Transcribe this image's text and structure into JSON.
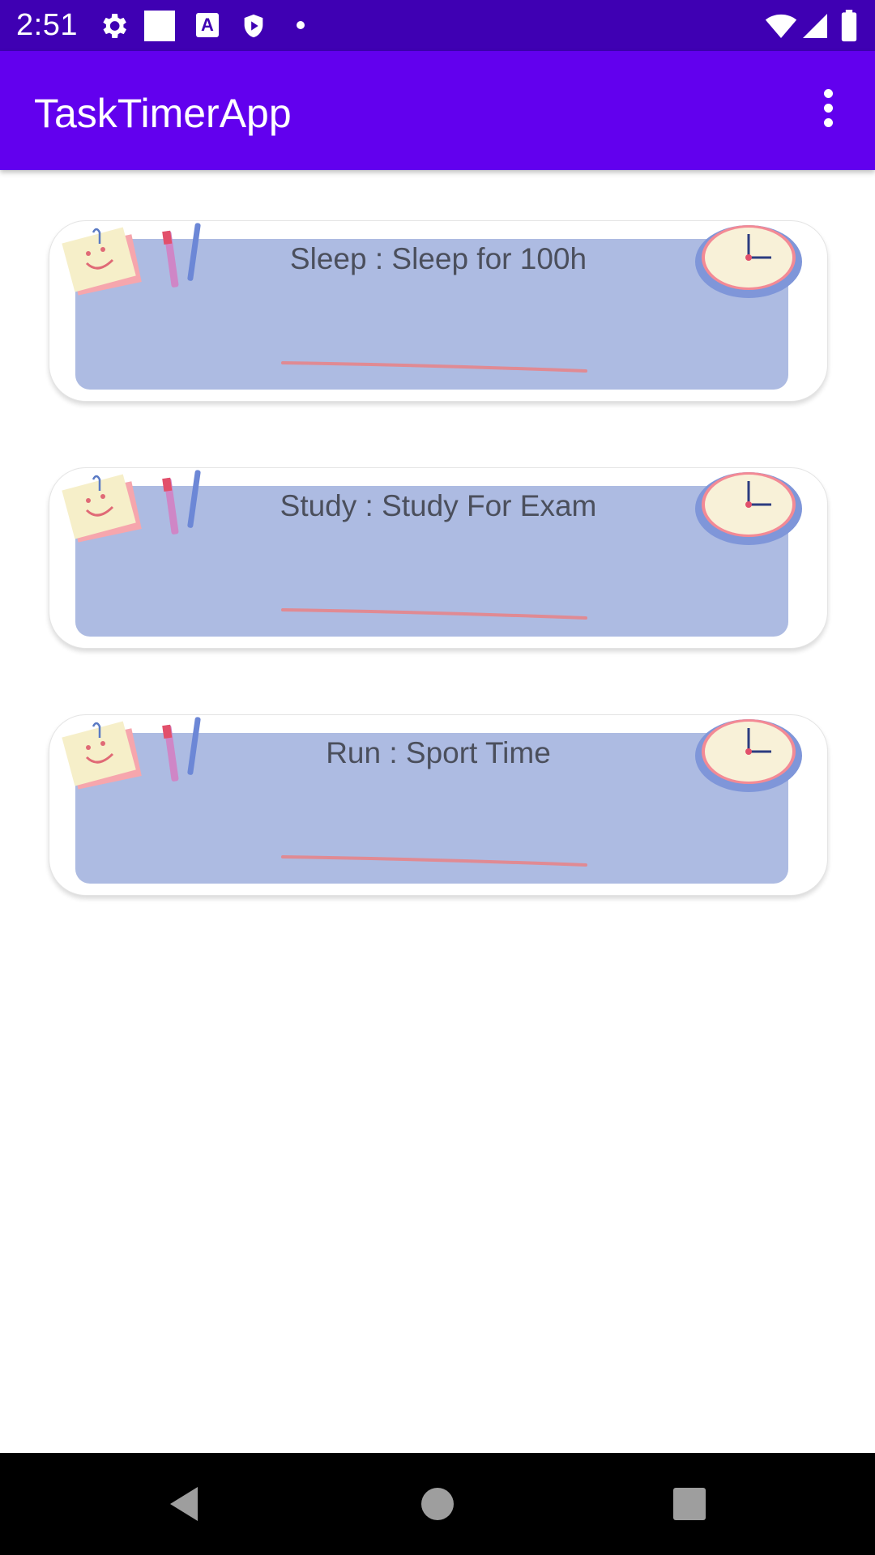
{
  "status_bar": {
    "time": "2:51",
    "icons": [
      "settings-icon",
      "square-icon",
      "a-box-icon",
      "shield-icon",
      "dot-icon",
      "wifi-icon",
      "signal-icon",
      "battery-icon"
    ]
  },
  "app_bar": {
    "title": "TaskTimerApp",
    "overflow_icon": "more-vert-icon"
  },
  "tasks": [
    {
      "label": "Sleep : Sleep for 100h"
    },
    {
      "label": "Study : Study For Exam"
    },
    {
      "label": "Run : Sport Time"
    }
  ],
  "nav_bar": {
    "buttons": [
      "back-icon",
      "home-icon",
      "recents-icon"
    ]
  },
  "colors": {
    "status_bar": "#3f00b3",
    "app_bar": "#6200ee",
    "card_panel": "#adbbe2",
    "task_text": "#4b4f5c"
  }
}
